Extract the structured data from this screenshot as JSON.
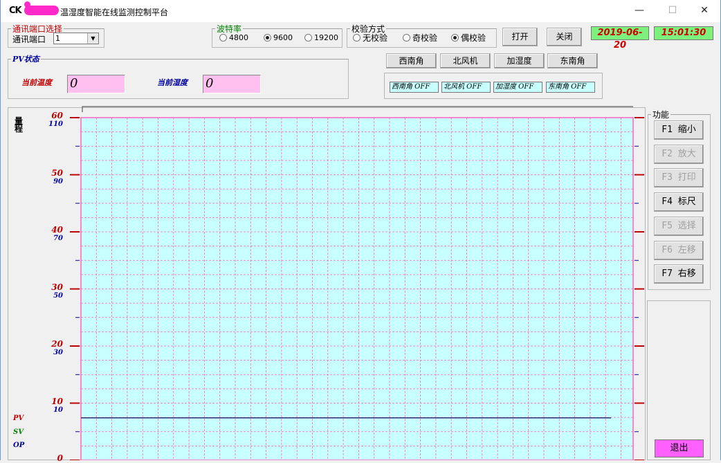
{
  "titlebar": {
    "icon": "CK",
    "title": "温湿度智能在线监测控制平台",
    "min": "—",
    "max": "☐",
    "close": "✕"
  },
  "port": {
    "legend": "通讯端口选择",
    "label": "通讯端口",
    "value": "1"
  },
  "baud": {
    "legend": "波特率",
    "options": [
      "4800",
      "9600",
      "19200"
    ],
    "selected": "9600"
  },
  "parity": {
    "legend": "校验方式",
    "options": [
      "无校验",
      "奇校验",
      "偶校验"
    ],
    "selected": "偶校验"
  },
  "buttons": {
    "open": "打开",
    "close": "关闭"
  },
  "datetime": {
    "date": "2019-06-20",
    "time": "15:01:30"
  },
  "pv": {
    "legend": "PV状态",
    "temp_label": "当前温度",
    "temp_value": "0",
    "hum_label": "当前湿度",
    "hum_value": "0"
  },
  "controls": [
    "西南角",
    "北风机",
    "加湿度",
    "东南角"
  ],
  "status": [
    "西南角 OFF",
    "北风机 OFF",
    "加湿度 OFF",
    "东南角 OFF"
  ],
  "range_label": "量程",
  "axis": {
    "temp_ticks": [
      "60",
      "50",
      "40",
      "30",
      "20",
      "10",
      "0"
    ],
    "hum_ticks": [
      "110",
      "90",
      "70",
      "50",
      "30",
      "10"
    ]
  },
  "legend_labels": {
    "pv": "PV",
    "sv": "SV",
    "op": "OP"
  },
  "functions": {
    "legend": "功能",
    "items": [
      {
        "label": "F1 缩小",
        "enabled": true
      },
      {
        "label": "F2 放大",
        "enabled": false
      },
      {
        "label": "F3 打印",
        "enabled": false
      },
      {
        "label": "F4 标尺",
        "enabled": true
      },
      {
        "label": "F5 选择",
        "enabled": false
      },
      {
        "label": "F6 左移",
        "enabled": false
      },
      {
        "label": "F7 右移",
        "enabled": true
      }
    ]
  },
  "exit": "退出",
  "colors": {
    "plot_bg": "#c8ffff",
    "grid": "#ff60c0",
    "temp_axis": "#c00000",
    "hum_axis": "#0000a0",
    "date_bg": "#7cf27c",
    "pv_box": "#ffc0f0",
    "exit_bg": "#ff60ff"
  },
  "chart_data": {
    "type": "line",
    "ylim": [
      0,
      60
    ],
    "series": [
      {
        "name": "OP",
        "values": [
          5,
          5
        ]
      }
    ]
  }
}
